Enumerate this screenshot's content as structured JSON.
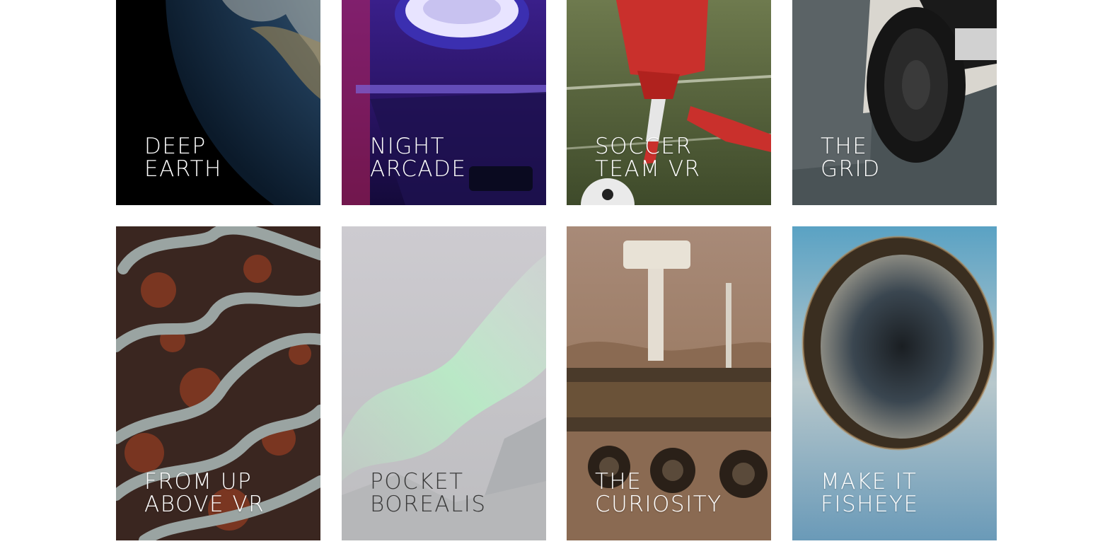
{
  "cards": [
    {
      "line1": "DEEP",
      "line2": "EARTH",
      "image": "earth-from-space"
    },
    {
      "line1": "NIGHT",
      "line2": "ARCADE",
      "image": "skee-ball-arcade"
    },
    {
      "line1": "SOCCER",
      "line2": "TEAM VR",
      "image": "soccer-player"
    },
    {
      "line1": "THE",
      "line2": "GRID",
      "image": "race-car-wheel"
    },
    {
      "line1": "FROM UP",
      "line2": "ABOVE VR",
      "image": "aerial-winding-road"
    },
    {
      "line1": "POCKET",
      "line2": "BOREALIS",
      "image": "aurora-borealis"
    },
    {
      "line1": "THE",
      "line2": "CURIOSITY",
      "image": "mars-rover"
    },
    {
      "line1": "MAKE IT",
      "line2": "FISHEYE",
      "image": "fisheye-planet"
    }
  ],
  "colors": {
    "background": "#ffffff",
    "title_light": "#ffffff",
    "title_dark": "#3a3a3a"
  }
}
